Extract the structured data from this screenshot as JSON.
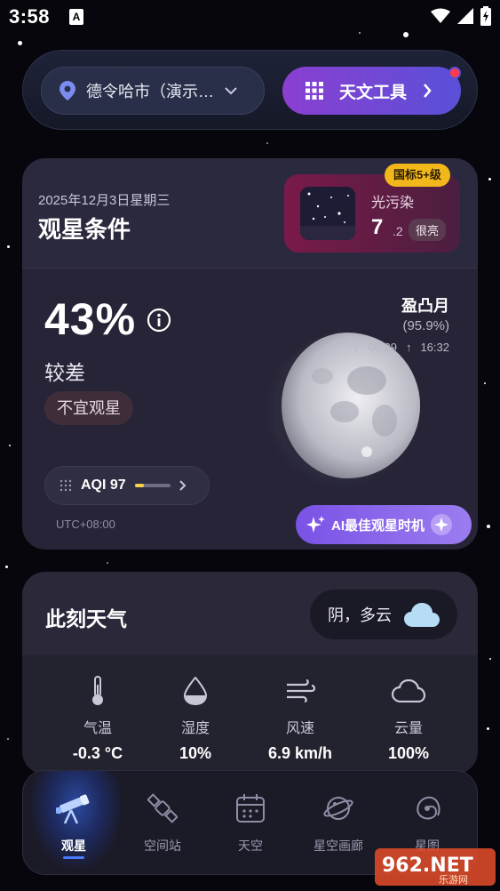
{
  "status_bar": {
    "time": "3:58",
    "notification": "A"
  },
  "top_bar": {
    "location": "德令哈市（演示…",
    "tools_label": "天文工具"
  },
  "observation": {
    "date": "2025年12月3日星期三",
    "title": "观星条件",
    "light_pollution": {
      "label": "光污染",
      "value": "7",
      "sub": ".2",
      "badge": "很亮",
      "standard": "国标5+级"
    },
    "score": "43%",
    "condition": "较差",
    "advice": "不宜观星",
    "moon": {
      "phase": "盈凸月",
      "illumination": "(95.9%)",
      "set_time": "06:29",
      "rise_time": "16:32"
    },
    "aqi": {
      "label": "AQI 97",
      "level": 0.25
    },
    "timezone": "UTC+08:00",
    "ai_button": "AI最佳观星时机"
  },
  "weather": {
    "title": "此刻天气",
    "condition": "阴，多云",
    "metrics": [
      {
        "label": "气温",
        "value": "-0.3 °C",
        "icon": "thermometer-icon"
      },
      {
        "label": "湿度",
        "value": "10%",
        "icon": "humidity-icon"
      },
      {
        "label": "风速",
        "value": "6.9 km/h",
        "icon": "wind-icon"
      },
      {
        "label": "云量",
        "value": "100%",
        "icon": "cloud-icon"
      }
    ]
  },
  "nav": {
    "items": [
      {
        "label": "观星",
        "icon": "telescope-icon",
        "active": true
      },
      {
        "label": "空间站",
        "icon": "satellite-icon",
        "active": false
      },
      {
        "label": "天空",
        "icon": "calendar-icon",
        "active": false
      },
      {
        "label": "星空画廊",
        "icon": "planet-icon",
        "active": false
      },
      {
        "label": "星图",
        "icon": "galaxy-icon",
        "active": false
      }
    ]
  },
  "watermark": {
    "brand": "962.NET",
    "sub": "乐游网"
  },
  "colors": {
    "accent_purple": "#8a3fd0",
    "accent_blue": "#4a7bff",
    "standard_badge": "#f2b71b",
    "aqi_indicator": "#f7d24a",
    "red_dot": "#ff3b4a"
  }
}
